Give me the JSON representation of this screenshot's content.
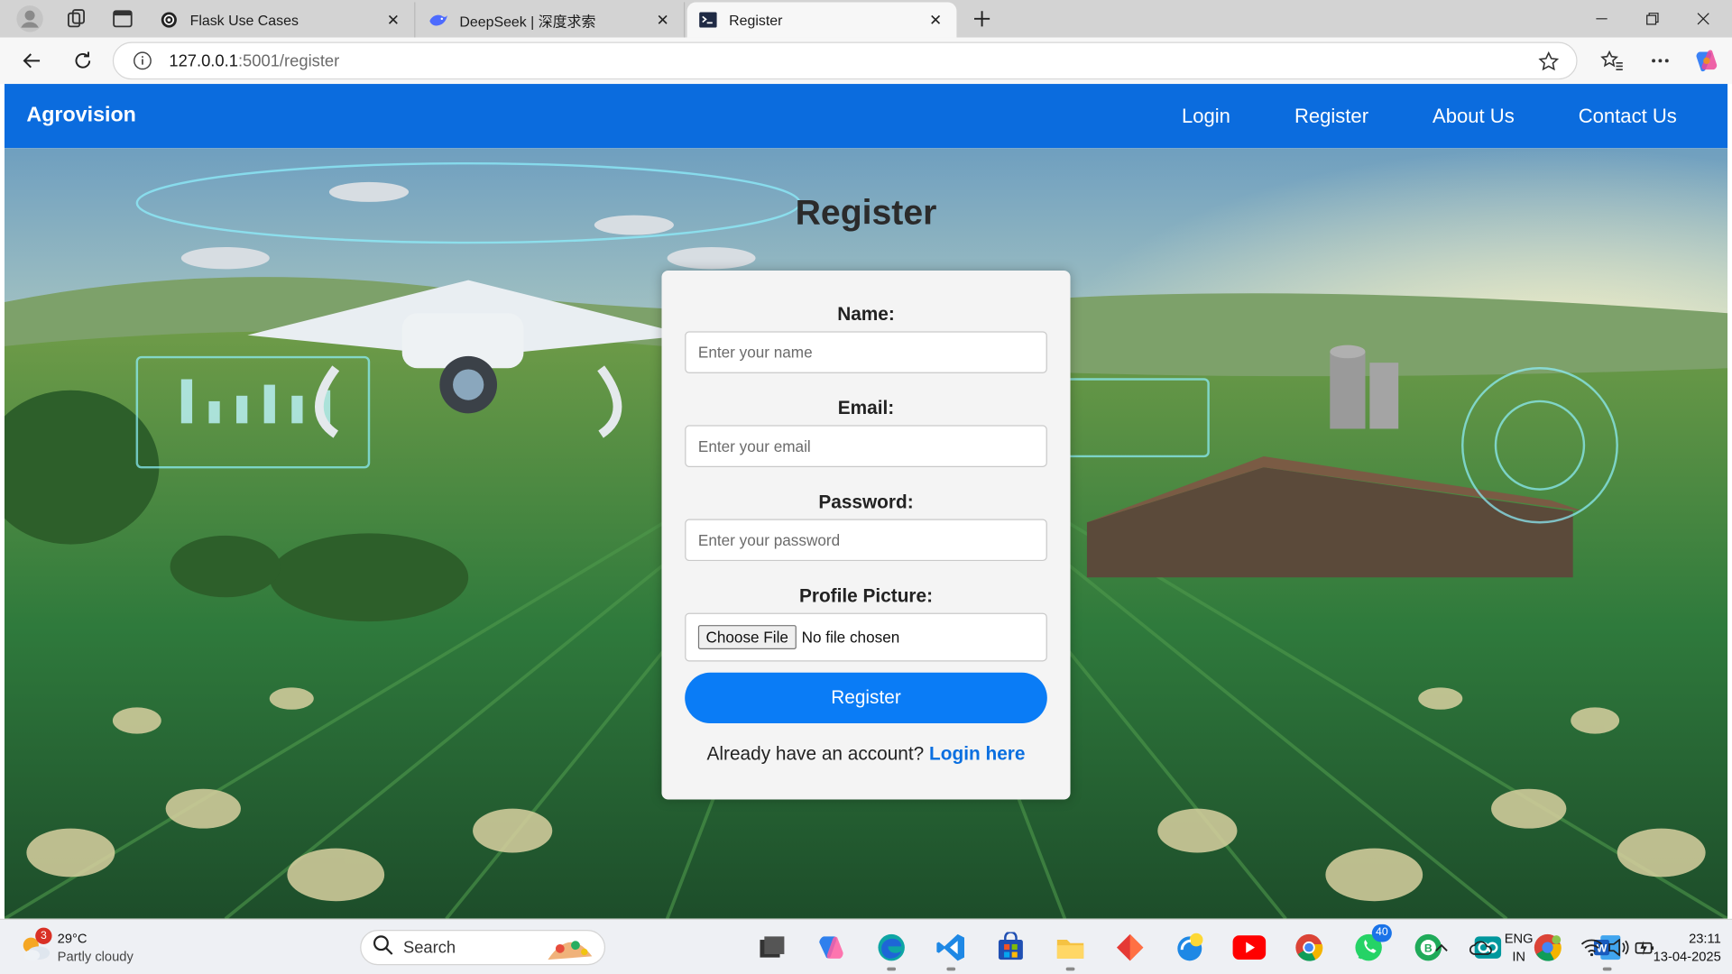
{
  "browser": {
    "tabs": [
      {
        "title": "Flask Use Cases",
        "icon": "flask-icon",
        "active": false
      },
      {
        "title": "DeepSeek | 深度求索",
        "icon": "deepseek-whale-icon",
        "active": false
      },
      {
        "title": "Register",
        "icon": "terminal-icon",
        "active": true
      }
    ],
    "url_host": "127.0.0.1",
    "url_rest": ":5001/register"
  },
  "navbar": {
    "brand": "Agrovision",
    "links": [
      "Login",
      "Register",
      "About Us",
      "Contact Us"
    ],
    "color": "#0b6cde"
  },
  "page": {
    "heading": "Register"
  },
  "form": {
    "name_label": "Name:",
    "name_placeholder": "Enter your name",
    "email_label": "Email:",
    "email_placeholder": "Enter your email",
    "password_label": "Password:",
    "password_placeholder": "Enter your password",
    "picture_label": "Profile Picture:",
    "file_button": "Choose File",
    "file_status": "No file chosen",
    "submit": "Register",
    "footer_text": "Already have an account?",
    "footer_link": "Login here",
    "accent": "#0a7cf6"
  },
  "taskbar": {
    "weather_badge": "3",
    "weather_temp": "29°C",
    "weather_desc": "Partly cloudy",
    "search_placeholder": "Search",
    "whatsapp_badge": "40",
    "lang_top": "ENG",
    "lang_bottom": "IN",
    "time": "23:11",
    "date": "13-04-2025"
  }
}
